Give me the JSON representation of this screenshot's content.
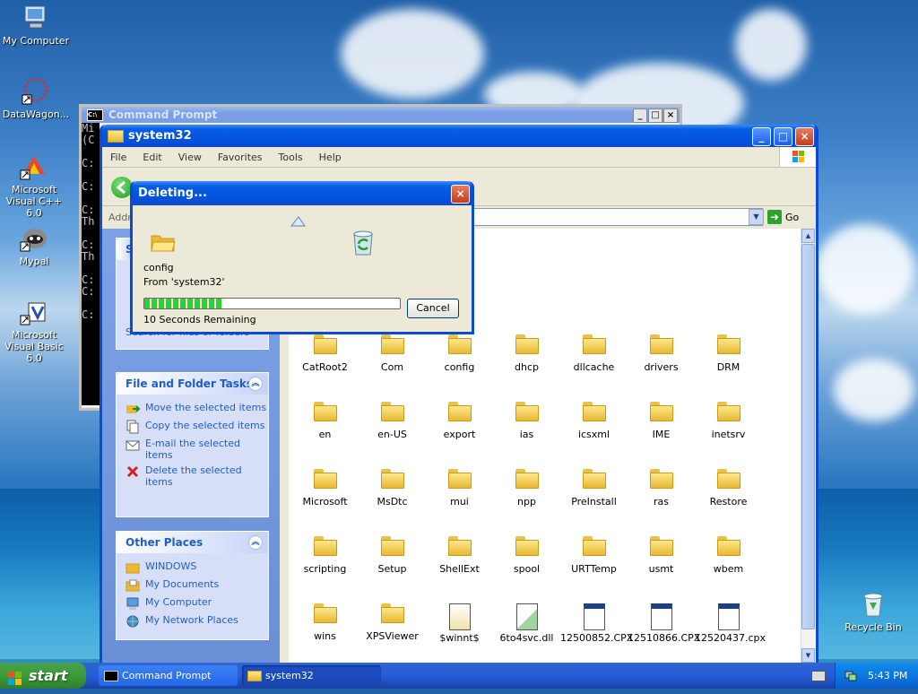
{
  "desktop": {
    "icons": [
      {
        "label": "My Computer",
        "icon": "computer-icon"
      },
      {
        "label": "DataWagon...",
        "icon": "datawagon-icon"
      },
      {
        "label": "Microsoft Visual C++ 6.0",
        "icon": "visual-cpp-icon"
      },
      {
        "label": "Mypal",
        "icon": "raccoon-icon"
      },
      {
        "label": "Microsoft Visual Basic 6.0",
        "icon": "visual-basic-icon"
      },
      {
        "label": "Recycle Bin",
        "icon": "recycle-bin-icon"
      }
    ]
  },
  "cmd_window": {
    "title": "Command Prompt",
    "lines": [
      "Mi",
      "(C",
      "",
      "C:",
      "",
      "C:",
      "",
      "C:",
      "Th",
      "",
      "C:",
      "Th",
      "",
      "C:",
      "C:",
      "",
      "C:"
    ]
  },
  "explorer": {
    "title": "system32",
    "menu": [
      "File",
      "Edit",
      "View",
      "Favorites",
      "Tools",
      "Help"
    ],
    "address_label": "Addre",
    "go_label": "Go",
    "left_panels": {
      "partial_top": {
        "visible_label": "Search for files or folders"
      },
      "file_tasks": {
        "title": "File and Folder Tasks",
        "items": [
          "Move the selected items",
          "Copy the selected items",
          "E-mail the selected items",
          "Delete the selected items"
        ]
      },
      "other_places": {
        "title": "Other Places",
        "items": [
          "WINDOWS",
          "My Documents",
          "My Computer",
          "My Network Places"
        ]
      }
    },
    "files": [
      [
        "CatRoot2",
        "Com",
        "config",
        "dhcp",
        "dllcache",
        "drivers",
        "DRM"
      ],
      [
        "en",
        "en-US",
        "export",
        "ias",
        "icsxml",
        "IME",
        "inetsrv"
      ],
      [
        "Microsoft",
        "MsDtc",
        "mui",
        "npp",
        "PreInstall",
        "ras",
        "Restore"
      ],
      [
        "scripting",
        "Setup",
        "ShellExt",
        "spool",
        "URTTemp",
        "usmt",
        "wbem"
      ],
      [
        "wins",
        "XPSViewer",
        "$winnt$",
        "6to4svc.dll",
        "12500852.CPX",
        "12510866.CPX",
        "12520437.cpx"
      ]
    ],
    "file_kinds": [
      [
        "folder",
        "folder",
        "folder",
        "folder",
        "folder",
        "folder",
        "folder"
      ],
      [
        "folder",
        "folder",
        "folder",
        "folder",
        "folder",
        "folder",
        "folder"
      ],
      [
        "folder",
        "folder",
        "folder",
        "folder",
        "folder",
        "folder",
        "folder"
      ],
      [
        "folder",
        "folder",
        "folder",
        "folder",
        "folder",
        "folder",
        "folder"
      ],
      [
        "folder",
        "folder",
        "setup",
        "dll",
        "cpx",
        "cpx",
        "cpx"
      ]
    ]
  },
  "dialog": {
    "title": "Deleting...",
    "item_name": "config",
    "from": "From 'system32'",
    "remaining": "10 Seconds Remaining",
    "progress": 0.31,
    "cancel_label": "Cancel"
  },
  "taskbar": {
    "start_label": "start",
    "items": [
      {
        "label": "Command Prompt"
      },
      {
        "label": "system32"
      }
    ],
    "clock": "5:43 PM"
  }
}
